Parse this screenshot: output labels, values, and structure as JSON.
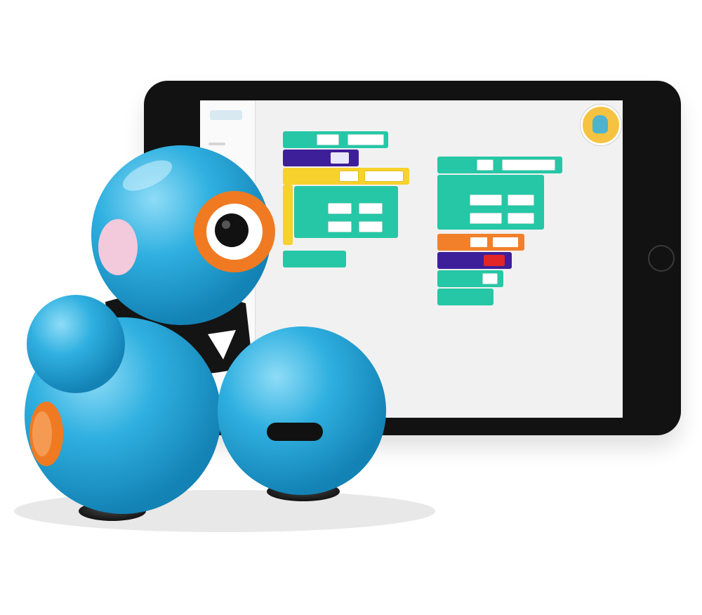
{
  "tablet": {
    "device": "tablet",
    "app_screen": {
      "blocks_left": [
        {
          "label": "",
          "color": "#25c7a6"
        },
        {
          "label": "",
          "color": "#3d1f9a"
        },
        {
          "label": "",
          "color": "#f7d12c"
        },
        {
          "label": "",
          "color": "#25c7a6"
        },
        {
          "label": "",
          "color": "#25c7a6"
        },
        {
          "label": "",
          "color": "#25c7a6"
        },
        {
          "label": "",
          "color": "#25c7a6"
        }
      ],
      "blocks_right": [
        {
          "label": "",
          "color": "#25c7a6"
        },
        {
          "label": "",
          "color": "#25c7a6"
        },
        {
          "label": "",
          "color": "#25c7a6"
        },
        {
          "label": "",
          "color": "#25c7a6"
        },
        {
          "label": "",
          "color": "#f2802a"
        },
        {
          "label": "",
          "color": "#3d1f9a"
        },
        {
          "label": "",
          "color": "#25c7a6"
        },
        {
          "label": "",
          "color": "#25c7a6"
        }
      ],
      "avatar_icon": "character-avatar-icon"
    }
  },
  "robot": {
    "kind": "toy-robot",
    "body_color": "#2fb0e0",
    "accent_color": "#f07a22",
    "eye_color": "#111111"
  }
}
